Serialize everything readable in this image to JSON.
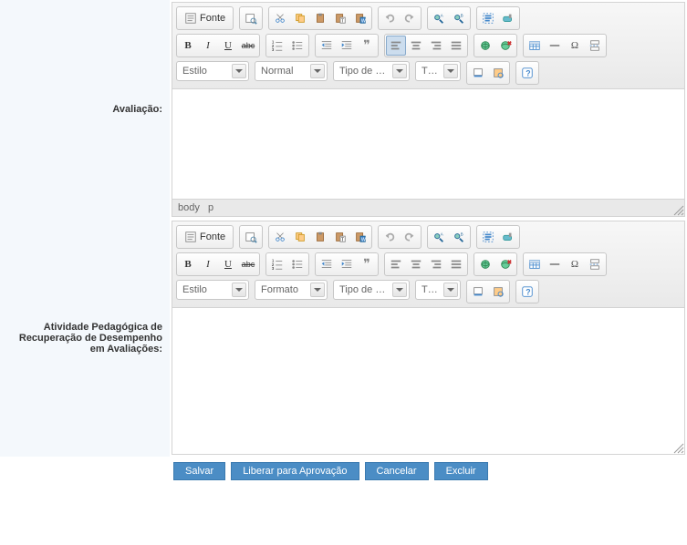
{
  "labels": {
    "avaliacao": "Avaliação:",
    "atividade": "Atividade Pedagógica de Recuperação de Desempenho em Avaliações:"
  },
  "toolbar": {
    "fonte": "Fonte"
  },
  "dropdowns": {
    "estilo": "Estilo",
    "normal": "Normal",
    "formato": "Formato",
    "tipo": "Tipo de …",
    "t": "T…"
  },
  "status": {
    "body": "body",
    "p": "p"
  },
  "buttons": {
    "salvar": "Salvar",
    "liberar": "Liberar para Aprovação",
    "cancelar": "Cancelar",
    "excluir": "Excluir"
  }
}
